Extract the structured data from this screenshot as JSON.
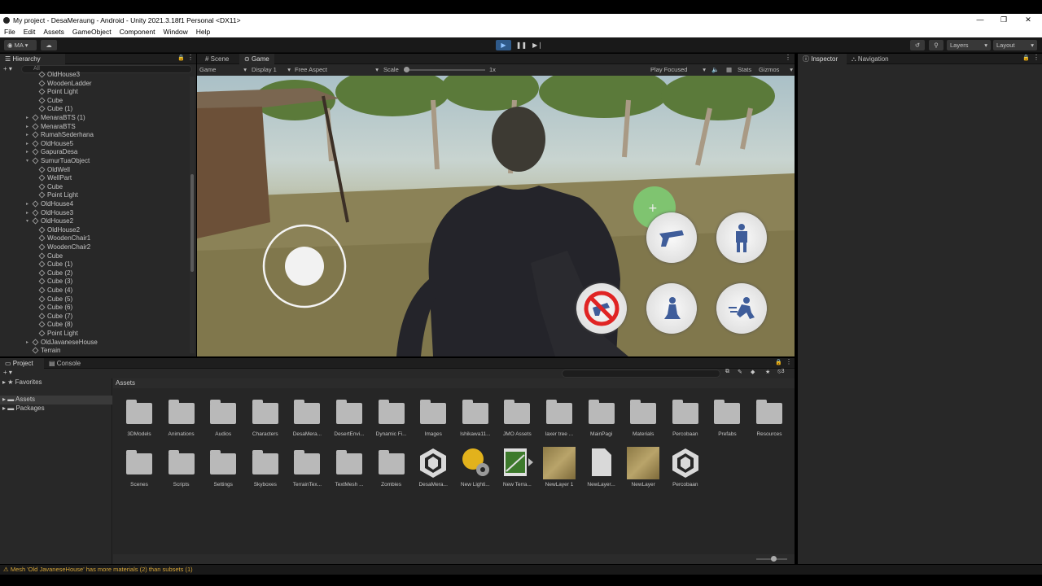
{
  "window": {
    "title": "My project - DesaMeraung - Android - Unity 2021.3.18f1 Personal <DX11>"
  },
  "menu": [
    "File",
    "Edit",
    "Assets",
    "GameObject",
    "Component",
    "Window",
    "Help"
  ],
  "toolbar": {
    "account": "MA",
    "layers": "Layers",
    "layout": "Layout"
  },
  "hierarchy": {
    "tab": "Hierarchy",
    "search_placeholder": "All",
    "items": [
      {
        "label": "OldHouse3",
        "depth": 2,
        "fold": ""
      },
      {
        "label": "WoodenLadder",
        "depth": 2,
        "fold": ""
      },
      {
        "label": "Point Light",
        "depth": 2,
        "fold": ""
      },
      {
        "label": "Cube",
        "depth": 2,
        "fold": ""
      },
      {
        "label": "Cube (1)",
        "depth": 2,
        "fold": ""
      },
      {
        "label": "MenaraBTS (1)",
        "depth": 1,
        "fold": "closed"
      },
      {
        "label": "MenaraBTS",
        "depth": 1,
        "fold": "closed"
      },
      {
        "label": "RumahSederhana",
        "depth": 1,
        "fold": "closed"
      },
      {
        "label": "OldHouse5",
        "depth": 1,
        "fold": "closed"
      },
      {
        "label": "GapuraDesa",
        "depth": 1,
        "fold": "closed"
      },
      {
        "label": "SumurTuaObject",
        "depth": 1,
        "fold": "open"
      },
      {
        "label": "OldWell",
        "depth": 2,
        "fold": ""
      },
      {
        "label": "WellPart",
        "depth": 2,
        "fold": ""
      },
      {
        "label": "Cube",
        "depth": 2,
        "fold": ""
      },
      {
        "label": "Point Light",
        "depth": 2,
        "fold": ""
      },
      {
        "label": "OldHouse4",
        "depth": 1,
        "fold": "closed"
      },
      {
        "label": "OldHouse3",
        "depth": 1,
        "fold": "closed"
      },
      {
        "label": "OldHouse2",
        "depth": 1,
        "fold": "open"
      },
      {
        "label": "OldHouse2",
        "depth": 2,
        "fold": ""
      },
      {
        "label": "WoodenChair1",
        "depth": 2,
        "fold": ""
      },
      {
        "label": "WoodenChair2",
        "depth": 2,
        "fold": ""
      },
      {
        "label": "Cube",
        "depth": 2,
        "fold": ""
      },
      {
        "label": "Cube (1)",
        "depth": 2,
        "fold": ""
      },
      {
        "label": "Cube (2)",
        "depth": 2,
        "fold": ""
      },
      {
        "label": "Cube (3)",
        "depth": 2,
        "fold": ""
      },
      {
        "label": "Cube (4)",
        "depth": 2,
        "fold": ""
      },
      {
        "label": "Cube (5)",
        "depth": 2,
        "fold": ""
      },
      {
        "label": "Cube (6)",
        "depth": 2,
        "fold": ""
      },
      {
        "label": "Cube (7)",
        "depth": 2,
        "fold": ""
      },
      {
        "label": "Cube (8)",
        "depth": 2,
        "fold": ""
      },
      {
        "label": "Point Light",
        "depth": 2,
        "fold": ""
      },
      {
        "label": "OldJavaneseHouse",
        "depth": 1,
        "fold": "closed"
      },
      {
        "label": "Terrain",
        "depth": 1,
        "fold": ""
      }
    ]
  },
  "game_view": {
    "tabs": [
      "Scene",
      "Game"
    ],
    "mode": "Game",
    "display": "Display 1",
    "aspect": "Free Aspect",
    "scale_label": "Scale",
    "scale_value": "1x",
    "play_focused": "Play Focused",
    "stats": "Stats",
    "gizmos": "Gizmos"
  },
  "inspector": {
    "tabs": [
      "Inspector",
      "Navigation"
    ]
  },
  "project": {
    "tabs": [
      "Project",
      "Console"
    ],
    "sidebar": {
      "favorites": "Favorites",
      "assets": "Assets",
      "packages": "Packages"
    },
    "breadcrumb": "Assets",
    "hidden_count": "3",
    "assets_row1": [
      "3DModels",
      "Animations",
      "Audios",
      "Characters",
      "DesaMera...",
      "DesertEnvi...",
      "Dynamic Fi...",
      "Images",
      "Ishikawa11...",
      "JMO Assets",
      "laxer tree ...",
      "MainPagi",
      "Materials",
      "Percobaan",
      "Prefabs",
      "Resources"
    ],
    "assets_row2": [
      {
        "label": "Scenes",
        "kind": "folder"
      },
      {
        "label": "Scripts",
        "kind": "folder"
      },
      {
        "label": "Settings",
        "kind": "folder"
      },
      {
        "label": "Skyboxes",
        "kind": "folder"
      },
      {
        "label": "TerrainTex...",
        "kind": "folder"
      },
      {
        "label": "TextMesh ...",
        "kind": "folder"
      },
      {
        "label": "Zombies",
        "kind": "folder"
      },
      {
        "label": "DesaMera...",
        "kind": "unity-scene"
      },
      {
        "label": "New Lighti...",
        "kind": "lighting"
      },
      {
        "label": "New Terra...",
        "kind": "terrain"
      },
      {
        "label": "NewLayer 1",
        "kind": "texture"
      },
      {
        "label": "NewLayer...",
        "kind": "file"
      },
      {
        "label": "NewLayer",
        "kind": "texture"
      },
      {
        "label": "Percobaan",
        "kind": "unity-scene"
      }
    ]
  },
  "status": {
    "message": "Mesh 'Old JavaneseHouse' has more materials (2) than subsets (1)"
  }
}
